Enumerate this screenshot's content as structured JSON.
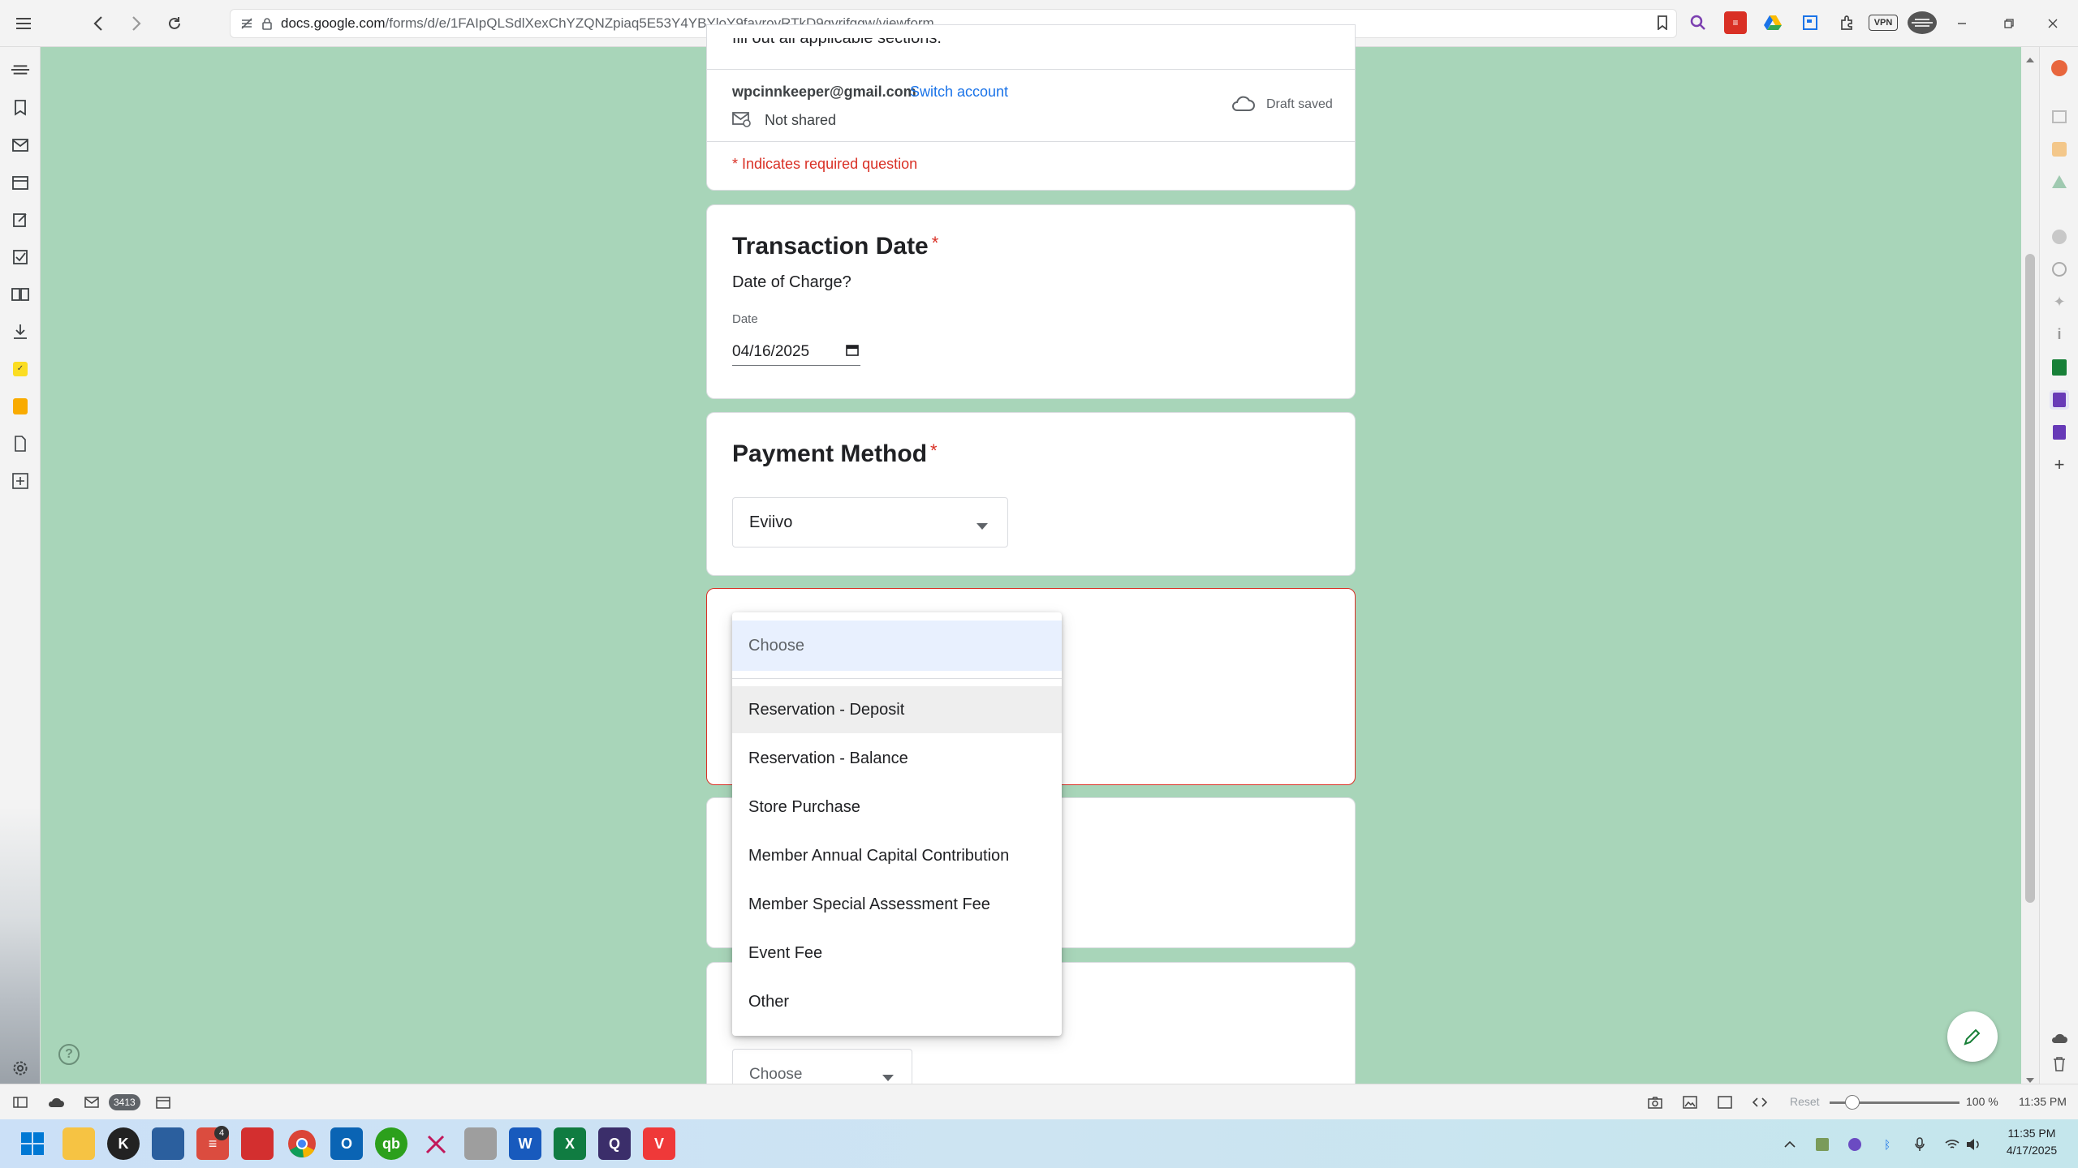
{
  "browser": {
    "url_host": "docs.google.com",
    "url_path": "/forms/d/e/1FAIpQLSdlXexChYZQNZpiaq5E53Y4YBYloY9fayrovRTkD9gvrjfggw/viewform",
    "vpn_label": "VPN"
  },
  "form": {
    "intro_text": "fill out all applicable sections.",
    "account_email": "wpcinnkeeper@gmail.com",
    "switch_account": "Switch account",
    "not_shared": "Not shared",
    "draft_saved": "Draft saved",
    "required_note": "* Indicates required question",
    "transaction_date": {
      "title": "Transaction Date",
      "required_mark": "*",
      "description": "Date of Charge?",
      "field_label": "Date",
      "value": "04/16/2025"
    },
    "payment_method": {
      "title": "Payment Method",
      "required_mark": "*",
      "selected": "Eviivo"
    },
    "bottom_select": {
      "placeholder": "Choose"
    }
  },
  "dropdown": {
    "placeholder": "Choose",
    "options": [
      "Reservation - Deposit",
      "Reservation - Balance",
      "Store Purchase",
      "Member Annual Capital Contribution",
      "Member Special Assessment Fee",
      "Event Fee",
      "Other"
    ]
  },
  "statusbar": {
    "mail_count": "3413",
    "reset_label": "Reset",
    "zoom": "100 %",
    "time": "11:35 PM"
  },
  "taskbar": {
    "badge_count": "4",
    "clock_time": "11:35 PM",
    "clock_date": "4/17/2025"
  }
}
